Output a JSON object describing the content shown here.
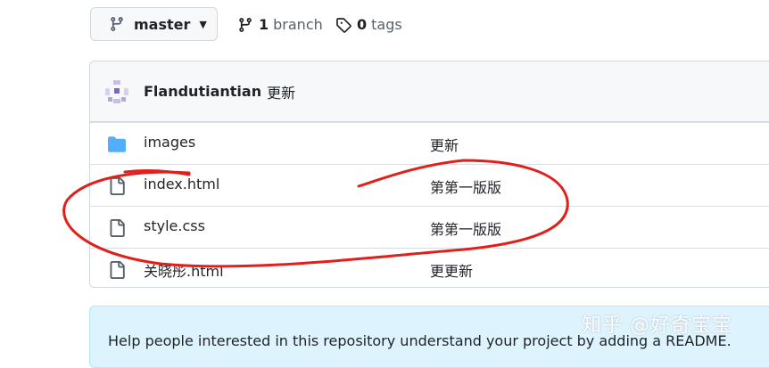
{
  "branch_selector": {
    "label": "master",
    "icon": "git-branch-icon"
  },
  "branches": {
    "count": "1",
    "label": "branch"
  },
  "tags": {
    "count": "0",
    "label": "tags"
  },
  "latest_commit": {
    "author": "Flandutiantian",
    "message": "更新"
  },
  "files": [
    {
      "type": "folder",
      "name": "images",
      "message": "更新"
    },
    {
      "type": "file",
      "name": "index.html",
      "message": "第第一版版"
    },
    {
      "type": "file",
      "name": "style.css",
      "message": "第第一版版"
    },
    {
      "type": "file",
      "name": "关晓彤.html",
      "message": "更更新"
    }
  ],
  "readme_prompt": "Help people interested in this repository understand your project by adding a README.",
  "watermark": "知乎 @好奇宝宝",
  "colors": {
    "folder": "#54aeff",
    "annotation": "#e0201b",
    "readme_bg": "#ddf4ff"
  }
}
